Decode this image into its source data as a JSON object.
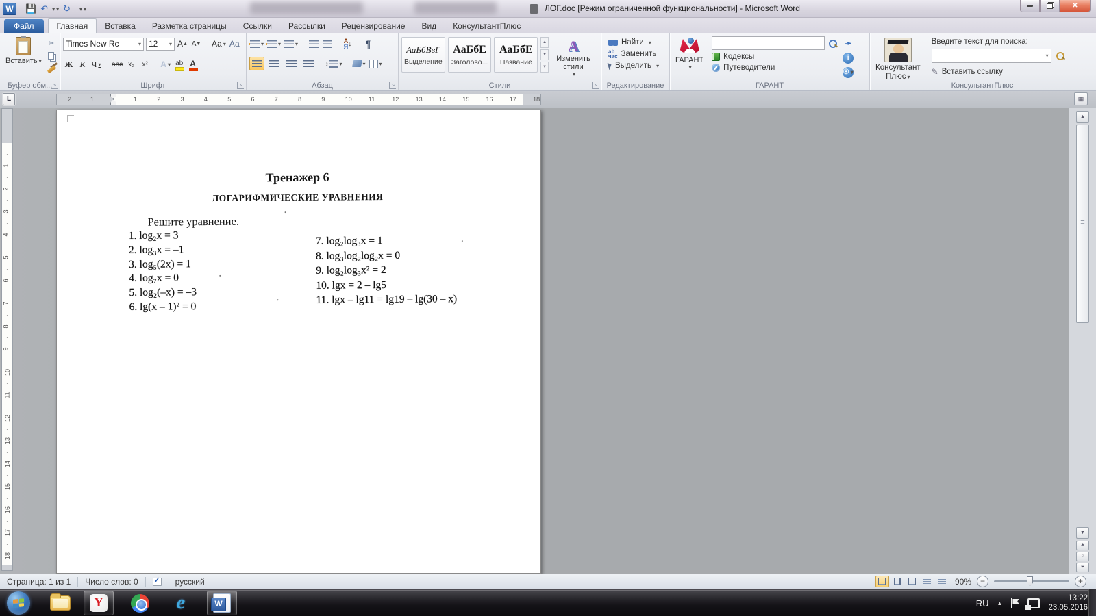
{
  "titlebar": {
    "title": "ЛОГ.doc [Режим ограниченной функциональности]  -  Microsoft Word"
  },
  "tabs": {
    "items": [
      {
        "label": "Файл"
      },
      {
        "label": "Главная"
      },
      {
        "label": "Вставка"
      },
      {
        "label": "Разметка страницы"
      },
      {
        "label": "Ссылки"
      },
      {
        "label": "Рассылки"
      },
      {
        "label": "Рецензирование"
      },
      {
        "label": "Вид"
      },
      {
        "label": "КонсультантПлюс"
      }
    ]
  },
  "ribbon": {
    "clipboard": {
      "label": "Буфер обм...",
      "paste": "Вставить"
    },
    "font": {
      "label": "Шрифт",
      "font_name": "Times New Rc",
      "font_size": "12",
      "bold": "Ж",
      "italic": "К",
      "underline": "Ч",
      "strike": "abc",
      "sub": "х₂",
      "sup": "х²",
      "grow": "А",
      "shrink": "А",
      "case": "Аа",
      "clear": "Аа",
      "outline": "А",
      "highlight": "ab",
      "color": "А"
    },
    "paragraph": {
      "label": "Абзац",
      "pilcrow": "¶",
      "sort_top": "А",
      "sort_bottom": "Я",
      "sort_arrow": "↓"
    },
    "styles": {
      "label": "Стили",
      "gallery": [
        {
          "sample": "АаБбВвГ",
          "name": "Выделение"
        },
        {
          "sample": "АаБбЕ",
          "name": "Заголово..."
        },
        {
          "sample": "АаБбЕ",
          "name": "Название"
        }
      ],
      "change_styles": "Изменить стили"
    },
    "editing": {
      "label": "Редактирование",
      "find": "Найти",
      "replace": "Заменить",
      "select": "Выделить"
    },
    "garant": {
      "label": "ГАРАНТ",
      "button": "ГАРАНТ",
      "codes": "Кодексы",
      "guides": "Путеводители"
    },
    "consultant": {
      "label": "КонсультантПлюс",
      "button_line1": "Консультант",
      "button_line2": "Плюс",
      "search_label": "Введите текст для поиска:",
      "insert_link": "Вставить ссылку"
    }
  },
  "ruler": {
    "tab_selector": "L",
    "h_margin_numbers": [
      "2",
      "1"
    ],
    "h_numbers": [
      "1",
      "2",
      "3",
      "4",
      "5",
      "6",
      "7",
      "8",
      "9",
      "10",
      "11",
      "12",
      "13",
      "14",
      "15",
      "16",
      "17",
      "18"
    ],
    "v_numbers": [
      "1",
      "2",
      "3",
      "4",
      "5",
      "6",
      "7",
      "8",
      "9",
      "10",
      "11",
      "12",
      "13",
      "14",
      "15",
      "16",
      "17",
      "18"
    ]
  },
  "document": {
    "title": "Тренажер 6",
    "subtitle": "ЛОГАРИФМИЧЕСКИЕ УРАВНЕНИЯ",
    "prompt": "Решите уравнение.",
    "equations_left": [
      "1. log₂x = 3",
      "2. log₃x = –1",
      "3. log₅(2x) = 1",
      "4. log₇x = 0",
      "5. log₂(–x) = –3",
      "6. lg(x – 1)² = 0"
    ],
    "equations_right": [
      "7. log₂log₃x = 1",
      "8. log₃log₂log₂x = 0",
      "9. log₂log₃x² = 2",
      "10. lgx = 2 – lg5",
      "11. lgx – lg11 = lg19 – lg(30 – x)"
    ]
  },
  "statusbar": {
    "page": "Страница: 1 из 1",
    "words": "Число слов: 0",
    "language": "русский",
    "zoom": "90%"
  },
  "taskbar": {
    "language": "RU",
    "time": "13:22",
    "date": "23.05.2016"
  }
}
